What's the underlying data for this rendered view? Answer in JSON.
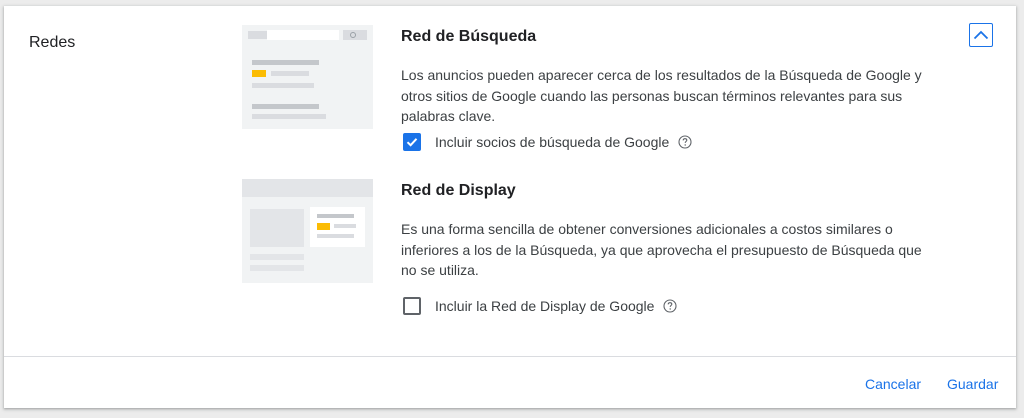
{
  "section": {
    "label": "Redes"
  },
  "collapse": {
    "icon": "chevron-up-icon"
  },
  "search_network": {
    "title": "Red de Búsqueda",
    "description": "Los anuncios pueden aparecer cerca de los resultados de la Búsqueda de Google y otros sitios de Google cuando las personas buscan términos relevantes para sus palabras clave.",
    "checkbox_label": "Incluir socios de búsqueda de Google",
    "checked": true,
    "help_icon": "help-circle-icon"
  },
  "display_network": {
    "title": "Red de Display",
    "description": "Es una forma sencilla de obtener conversiones adicionales a costos similares o inferiores a los de la Búsqueda, ya que aprovecha el presupuesto de Búsqueda que no se utiliza.",
    "checkbox_label": "Incluir la Red de Display de Google",
    "checked": false,
    "help_icon": "help-circle-icon"
  },
  "footer": {
    "cancel_label": "Cancelar",
    "save_label": "Guardar"
  },
  "colors": {
    "accent": "#1a73e8",
    "highlight": "#fbbc04",
    "text": "#202124",
    "muted": "#3c4043"
  }
}
